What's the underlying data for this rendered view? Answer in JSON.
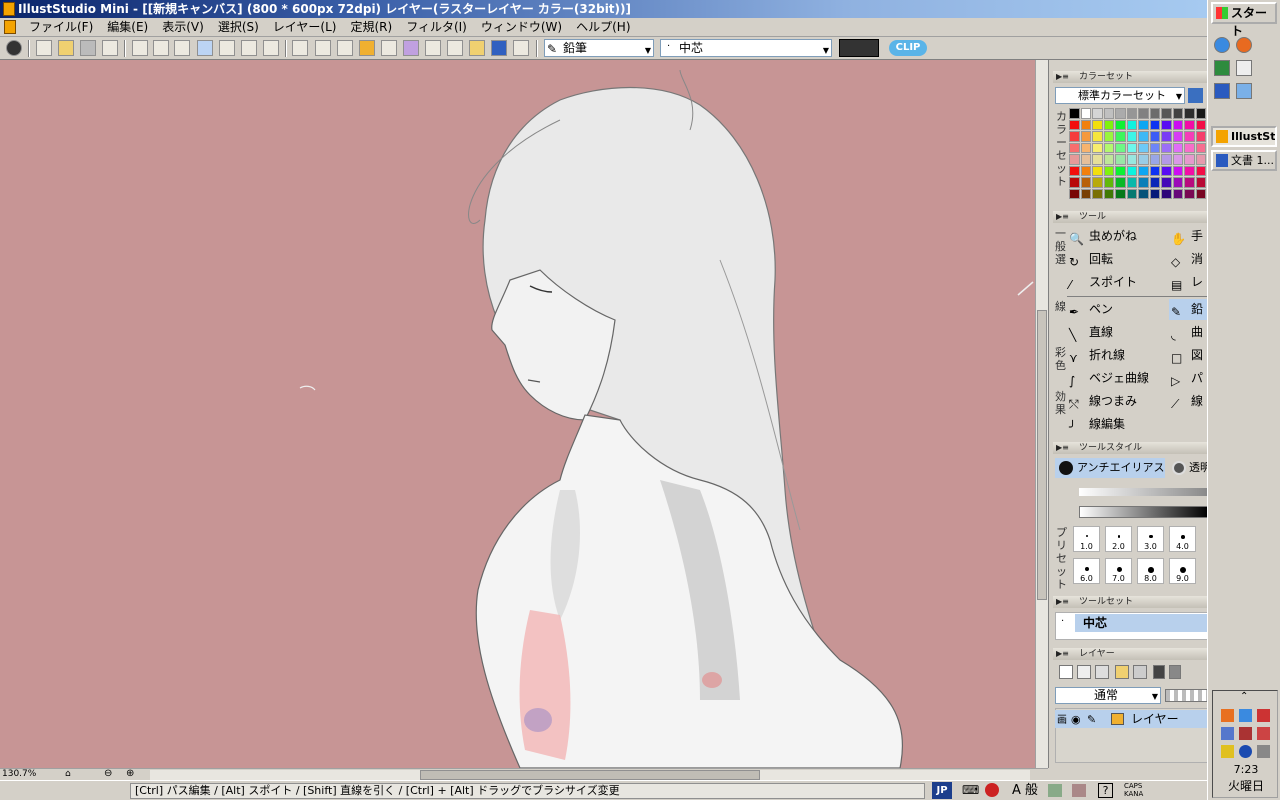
{
  "window": {
    "title": "IllustStudio Mini - [[新規キャンバス] (800 * 600px 72dpi)     レイヤー(ラスターレイヤー カラー(32bit))]"
  },
  "menu": [
    "ファイル(F)",
    "編集(E)",
    "表示(V)",
    "選択(S)",
    "レイヤー(L)",
    "定規(R)",
    "フィルタ(I)",
    "ウィンドウ(W)",
    "ヘルプ(H)"
  ],
  "toolbar": {
    "tool_combo": "鉛筆",
    "brush_combo": "中芯",
    "logo_text": "CLIP",
    "color_swatch": "#333333"
  },
  "canvas": {
    "bg_color": "#c79595",
    "zoom": "130.7%"
  },
  "status": {
    "message": "[Ctrl] パス編集 / [Alt] スポイト / [Shift] 直線を引く / [Ctrl] + [Alt] ドラッグでブラシサイズ変更",
    "lang": "JP",
    "ime": "A 般",
    "caps": "CAPS",
    "kana": "KANA"
  },
  "panels": {
    "colorset": {
      "title": "カラーセット",
      "preset": "標準カラーセット",
      "side_label": "カラーセット"
    },
    "tools": {
      "title": "ツール",
      "groups": [
        {
          "label": "一般選",
          "left": [
            "虫めがね",
            "回転",
            "スポイト"
          ],
          "right": [
            "手",
            "消",
            "レ"
          ]
        },
        {
          "label": "線",
          "left": [
            "ペン",
            "直線",
            "折れ線",
            "ベジェ曲線",
            "線つまみ",
            "線編集"
          ],
          "right": [
            "鉛",
            "曲",
            "図",
            "パ",
            "線",
            ""
          ]
        },
        {
          "label": "彩色",
          "left": [],
          "right": []
        },
        {
          "label": "効果",
          "left": [],
          "right": []
        }
      ]
    },
    "toolstyle": {
      "title": "ツールスタイル",
      "antialias": "アンチエイリアス",
      "transparent": "透明",
      "preset_label": "プリセット",
      "presets": [
        "1.0",
        "2.0",
        "3.0",
        "4.0",
        "6.0",
        "7.0",
        "8.0",
        "9.0"
      ]
    },
    "toolset": {
      "title": "ツールセット",
      "item": "中芯"
    },
    "layer": {
      "title": "レイヤー",
      "blend": "通常",
      "layer_name": "レイヤー"
    }
  },
  "taskbar": {
    "start": "スタート",
    "buttons": [
      "IllustStudio Mini",
      "文書 1..."
    ],
    "time": "7:23",
    "day": "火曜日"
  }
}
